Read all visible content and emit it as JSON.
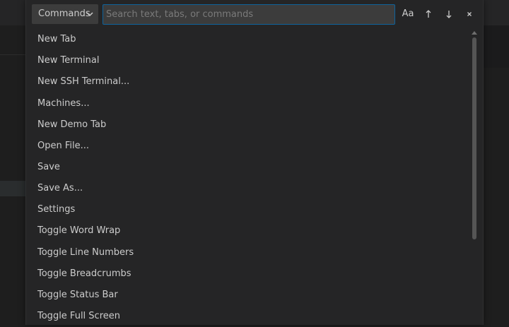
{
  "toolbar": {
    "mode_label": "Commands",
    "search_placeholder": "Search text, tabs, or commands",
    "search_value": "",
    "case_label": "Aa",
    "prev_icon": "arrow-up-icon",
    "next_icon": "arrow-down-icon",
    "close_icon": "close-icon"
  },
  "commands": [
    {
      "label": "New Tab"
    },
    {
      "label": "New Terminal"
    },
    {
      "label": "New SSH Terminal..."
    },
    {
      "label": "Machines..."
    },
    {
      "label": "New Demo Tab"
    },
    {
      "label": "Open File..."
    },
    {
      "label": "Save"
    },
    {
      "label": "Save As..."
    },
    {
      "label": "Settings"
    },
    {
      "label": "Toggle Word Wrap"
    },
    {
      "label": "Toggle Line Numbers"
    },
    {
      "label": "Toggle Breadcrumbs"
    },
    {
      "label": "Toggle Status Bar"
    },
    {
      "label": "Toggle Full Screen"
    }
  ],
  "colors": {
    "accent": "#0e639c",
    "panel": "#252526",
    "text": "#cccccc"
  }
}
